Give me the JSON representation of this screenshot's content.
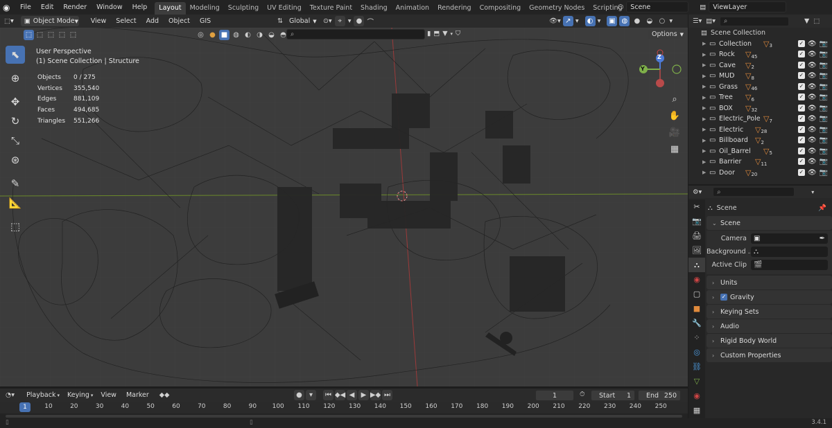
{
  "app": {
    "version": "3.4.1"
  },
  "topbar": {
    "menus": [
      "File",
      "Edit",
      "Render",
      "Window",
      "Help"
    ],
    "workspaces": [
      "Layout",
      "Modeling",
      "Sculpting",
      "UV Editing",
      "Texture Paint",
      "Shading",
      "Animation",
      "Rendering",
      "Compositing",
      "Geometry Nodes",
      "Scripting"
    ],
    "active_workspace": "Layout",
    "add_tab": "+",
    "scene": "Scene",
    "view_layer": "ViewLayer"
  },
  "viewport_header": {
    "mode": "Object Mode",
    "menus": [
      "View",
      "Select",
      "Add",
      "Object",
      "GIS"
    ],
    "transform_orientation": "Global",
    "options_label": "Options",
    "search_placeholder": ""
  },
  "viewport": {
    "perspective": "User Perspective",
    "collection_path": "(1) Scene Collection | Structure",
    "stats": [
      {
        "label": "Objects",
        "value": "0 / 275"
      },
      {
        "label": "Vertices",
        "value": "355,540"
      },
      {
        "label": "Edges",
        "value": "881,109"
      },
      {
        "label": "Faces",
        "value": "494,685"
      },
      {
        "label": "Triangles",
        "value": "551,266"
      }
    ],
    "gizmo": {
      "z": "Z",
      "y": "Y"
    }
  },
  "outliner": {
    "root": "Scene Collection",
    "items": [
      {
        "name": "Collection",
        "count": "3"
      },
      {
        "name": "Rock",
        "count": "45"
      },
      {
        "name": "Cave",
        "count": "2"
      },
      {
        "name": "MUD",
        "count": "8"
      },
      {
        "name": "Grass",
        "count": "46"
      },
      {
        "name": "Tree",
        "count": "6"
      },
      {
        "name": "BOX",
        "count": "32"
      },
      {
        "name": "Electric_Pole",
        "count": "7"
      },
      {
        "name": "Electric",
        "count": "28"
      },
      {
        "name": "Billboard",
        "count": "2"
      },
      {
        "name": "Oil_Barrel",
        "count": "5"
      },
      {
        "name": "Barrier",
        "count": "11"
      },
      {
        "name": "Door",
        "count": "20"
      }
    ]
  },
  "properties": {
    "context": "Scene",
    "scene_panel": "Scene",
    "fields": [
      {
        "label": "Camera",
        "value": ""
      },
      {
        "label": "Background ...",
        "value": ""
      },
      {
        "label": "Active Clip",
        "value": ""
      }
    ],
    "panels": [
      "Units",
      "Gravity",
      "Keying Sets",
      "Audio",
      "Rigid Body World",
      "Custom Properties"
    ],
    "gravity_checked": true
  },
  "timeline": {
    "menus": [
      "Playback",
      "Keying",
      "View",
      "Marker"
    ],
    "current_frame": "1",
    "start_label": "Start",
    "start": "1",
    "end_label": "End",
    "end": "250",
    "ruler_current": "1",
    "ruler_ticks": [
      "10",
      "20",
      "30",
      "40",
      "50",
      "60",
      "70",
      "80",
      "90",
      "100",
      "110",
      "120",
      "130",
      "140",
      "150",
      "160",
      "170",
      "180",
      "190",
      "200",
      "210",
      "220",
      "230",
      "240",
      "250"
    ]
  }
}
